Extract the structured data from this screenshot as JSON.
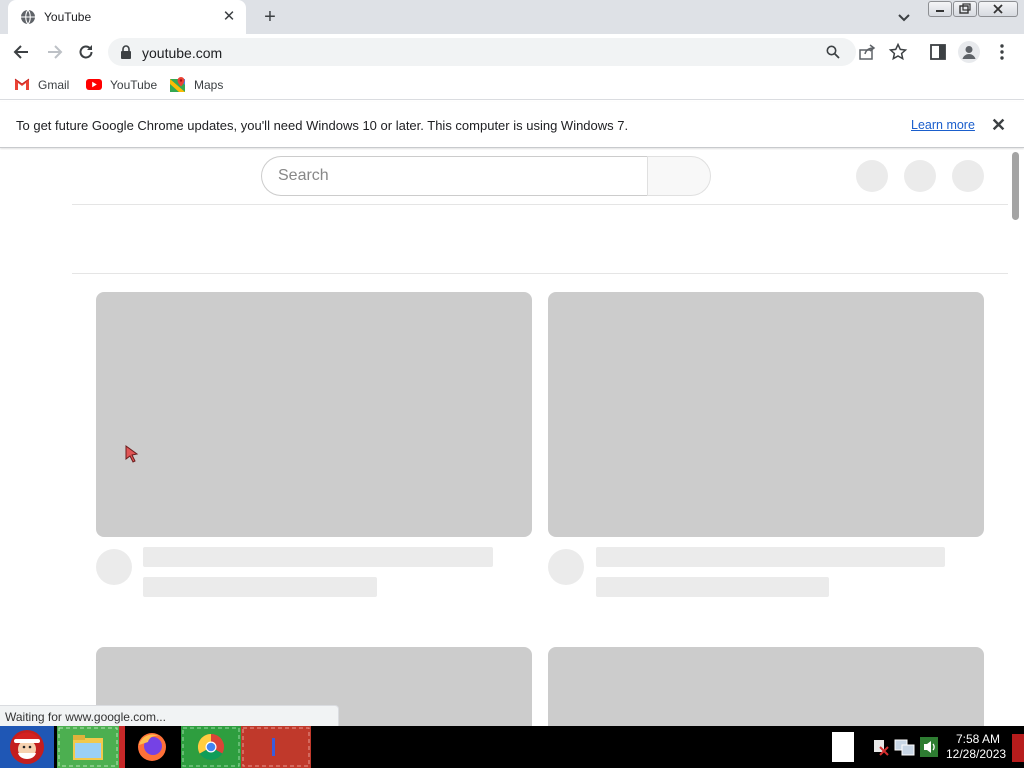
{
  "browser": {
    "tab_title": "YouTube",
    "new_tab_symbol": "+",
    "close_tab_symbol": "✕",
    "url": "youtube.com"
  },
  "bookmarks": [
    {
      "label": "Gmail",
      "icon": "gmail-icon"
    },
    {
      "label": "YouTube",
      "icon": "youtube-icon"
    },
    {
      "label": "Maps",
      "icon": "maps-icon"
    }
  ],
  "infobar": {
    "message": "To get future Google Chrome updates, you'll need Windows 10 or later. This computer is using Windows 7.",
    "link": "Learn more",
    "close_symbol": "✕"
  },
  "page": {
    "search_placeholder": "Search"
  },
  "status_text": "Waiting for www.google.com...",
  "taskbar": {
    "time": "7:58 AM",
    "date": "12/28/2023"
  },
  "colors": {
    "tabstrip": "#dee1e6",
    "skeleton_thumb": "#cccccc",
    "skeleton_text": "#ebebeb",
    "link": "#1a5ecc"
  }
}
